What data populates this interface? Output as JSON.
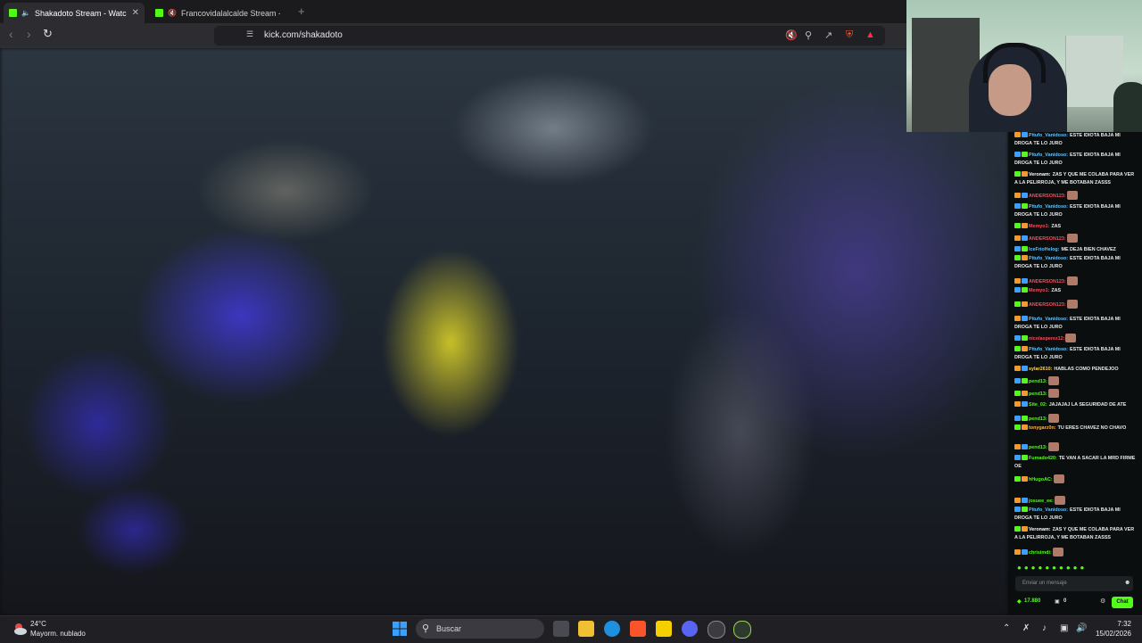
{
  "browser": {
    "tabs": [
      {
        "title": "Shakadoto Stream - Watch Li",
        "active": true
      },
      {
        "title": "Francovidalalcalde Stream - Watc",
        "active": false
      }
    ],
    "url": "kick.com/shakadoto",
    "new_tab": "+"
  },
  "chat": {
    "messages": [
      {
        "user": "Pitufo_Vanidoso:",
        "text": "ESTE IDIOTA BAJA MI DROGA TE LO JURO",
        "color": "#5ec2ff"
      },
      {
        "user": "Pitufo_Vanidoso:",
        "text": "ESTE IDIOTA BAJA MI DROGA TE LO JURO",
        "color": "#5ec2ff"
      },
      {
        "user": "Veronam:",
        "text": "ZAS Y QUE ME COLABA PARA VER A LA PELIRROJA, Y ME BOTABAN ZASSS",
        "color": "#ffffff"
      },
      {
        "user": "ANDERSON123:",
        "text": "",
        "color": "#ff4a5a",
        "emote": true
      },
      {
        "user": "Pitufo_Vanidoso:",
        "text": "ESTE IDIOTA BAJA MI DROGA TE LO JURO",
        "color": "#5ec2ff"
      },
      {
        "user": "Memyo1:",
        "text": "ZAS",
        "color": "#ff4a5a"
      },
      {
        "user": "ANDERSON123:",
        "text": "",
        "color": "#ff4a5a",
        "emote": true
      },
      {
        "user": "IceFrioHelog:",
        "text": "ME DEJA BIEN CHAVEZ",
        "color": "#5ec2ff"
      },
      {
        "user": "Pitufo_Vanidoso:",
        "text": "ESTE IDIOTA BAJA MI DROGA TE LO JURO",
        "color": "#5ec2ff"
      },
      {
        "user": "ANDERSON123:",
        "text": "",
        "color": "#ff4a5a",
        "emote": true
      },
      {
        "user": "Memyo1:",
        "text": "ZAS",
        "color": "#ff4a5a"
      },
      {
        "user": "ANDERSON123:",
        "text": "",
        "color": "#ff4a5a",
        "emote": true
      },
      {
        "user": "Pitufo_Vanidoso:",
        "text": "ESTE IDIOTA BAJA MI DROGA TE LO JURO",
        "color": "#5ec2ff"
      },
      {
        "user": "nicolasperez12:",
        "text": "",
        "color": "#ff4a5a",
        "emote": true
      },
      {
        "user": "Pitufo_Vanidoso:",
        "text": "ESTE IDIOTA BAJA MI DROGA TE LO JURO",
        "color": "#5ec2ff"
      },
      {
        "user": "sylar2610:",
        "text": "HABLAS COMO PENDEJOO",
        "color": "#ffd84a"
      },
      {
        "user": "pend13:",
        "text": "",
        "color": "#53fc18",
        "emote": true
      },
      {
        "user": "pend13:",
        "text": "",
        "color": "#53fc18",
        "emote": true
      },
      {
        "user": "Site_02:",
        "text": "JAJAJAJ LA SEGURIDAD DE ATE",
        "color": "#53fc18"
      },
      {
        "user": "pend13:",
        "text": "",
        "color": "#53fc18",
        "emote": true
      },
      {
        "user": "tonygarz0n:",
        "text": "TU ERES CHAVEZ NO CHAVO",
        "color": "#ffb347"
      },
      {
        "user": "pend13:",
        "text": "",
        "color": "#53fc18",
        "emote": true
      },
      {
        "user": "Fumado420:",
        "text": "TE VAN A SACAR LA MRD FIRME OE",
        "color": "#53fc18"
      },
      {
        "user": "hHugoAC:",
        "text": "",
        "color": "#53fc18",
        "emote": true
      },
      {
        "user": "josuee_ee:",
        "text": "",
        "color": "#53fc18",
        "emote": true
      },
      {
        "user": "Pitufo_Vanidoso:",
        "text": "ESTE IDIOTA BAJA MI DROGA TE LO JURO",
        "color": "#5ec2ff"
      },
      {
        "user": "Veronam:",
        "text": "ZAS Y QUE ME COLABA PARA VER A LA PELIRROJA, Y ME BOTABAN ZASSS",
        "color": "#ffffff"
      },
      {
        "user": "chrisimdi:",
        "text": "",
        "color": "#53fc18",
        "emote": true
      }
    ],
    "input_placeholder": "Enviar un mensaje",
    "points": "17.880",
    "count": "0",
    "chat_button": "Chat"
  },
  "taskbar": {
    "temperature": "24°C",
    "weather": "Mayorm. nublado",
    "search_label": "Buscar",
    "time": "7:32",
    "date": "15/02/2026"
  },
  "colors": {
    "kick_green": "#53fc18",
    "taskbar": "#202024"
  }
}
